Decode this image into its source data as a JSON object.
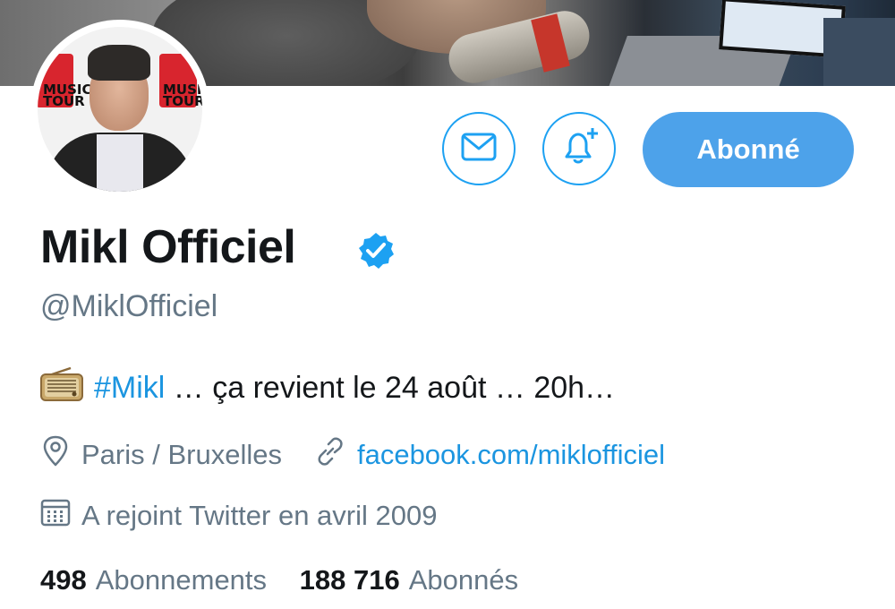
{
  "profile": {
    "name": "Mikl Officiel",
    "handle": "@MiklOfficiel",
    "avatar_logo": "MUSIC TOUR"
  },
  "actions": {
    "message_icon": "envelope-icon",
    "notify_icon": "bell-plus-icon",
    "follow_label": "Abonné"
  },
  "bio": {
    "emoji": "📻",
    "hashtag": "#Mikl",
    "text": " … ça revient le 24 août … 20h…"
  },
  "meta": {
    "location": "Paris / Bruxelles",
    "website": "facebook.com/miklofficiel",
    "joined": "A rejoint Twitter en avril 2009"
  },
  "stats": {
    "following_count": "498",
    "following_label": "Abonnements",
    "followers_count": "188 716",
    "followers_label": "Abonnés"
  },
  "colors": {
    "accent": "#1da1f2",
    "follow_bg": "#4da2ea",
    "secondary_text": "#657786",
    "link": "#1b95e0"
  }
}
